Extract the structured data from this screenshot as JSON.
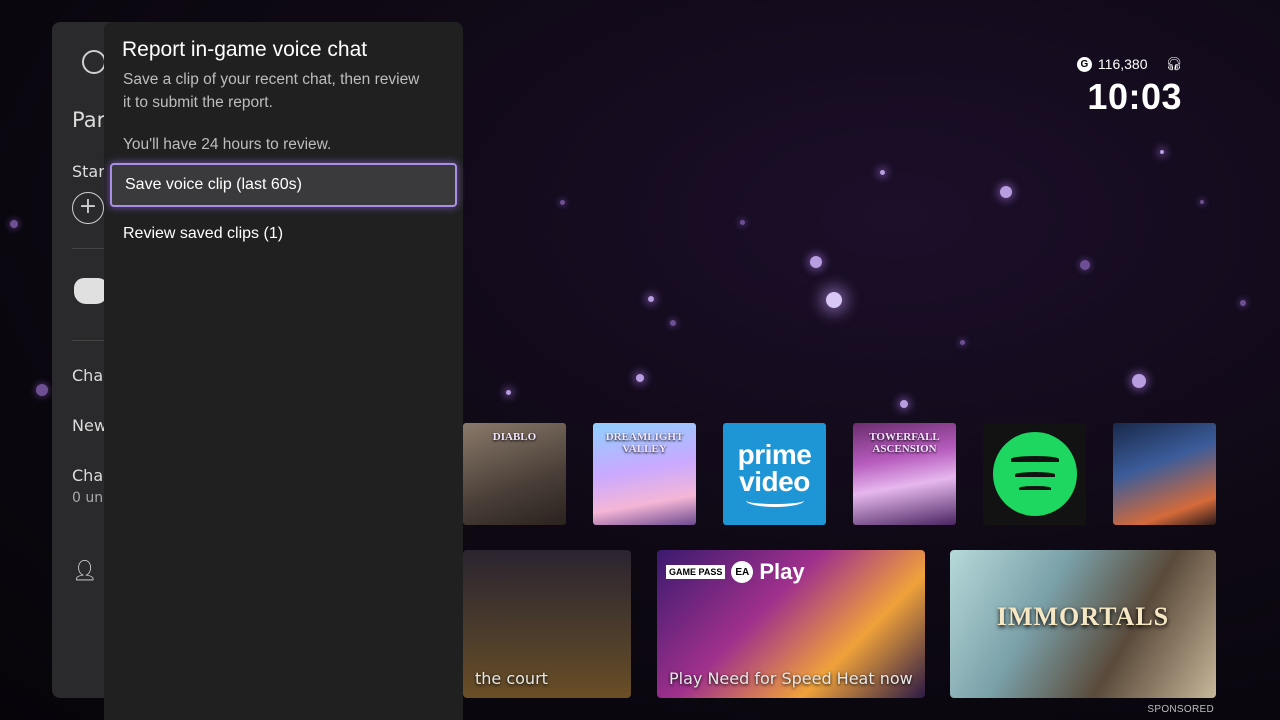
{
  "status_bar": {
    "gamerscore_icon": "G",
    "gamerscore": "116,380",
    "headset_icon": "headset-icon",
    "time": "10:03"
  },
  "tiles": [
    {
      "name": "diablo",
      "label": "DIABLO"
    },
    {
      "name": "dreamlight-valley",
      "label": "DREAMLIGHT VALLEY"
    },
    {
      "name": "prime-video",
      "label": "prime video"
    },
    {
      "name": "towerfall",
      "label": "TOWERFALL ASCENSION"
    },
    {
      "name": "spotify",
      "label": ""
    },
    {
      "name": "mass-effect",
      "label": ""
    }
  ],
  "cards": {
    "lakers_caption": "the court",
    "speed_badge_gp": "GAME PASS",
    "speed_badge_ea": "EA",
    "speed_badge_play": "Play",
    "speed_caption": "Play Need for Speed Heat now",
    "immortals_title": "IMMORTALS",
    "sponsored": "SPONSORED"
  },
  "party_panel": {
    "title": "Par",
    "start": "Star",
    "chat": "Cha",
    "news": "New",
    "chats": "Cha",
    "unread": "0 un"
  },
  "dialog": {
    "title": "Report in-game voice chat",
    "description": "Save a clip of your recent chat, then review it to submit the report.",
    "note": "You'll have 24 hours to review.",
    "options": [
      {
        "label": "Save voice clip (last 60s)",
        "selected": true
      },
      {
        "label": "Review saved clips (1)",
        "selected": false
      }
    ]
  },
  "colors": {
    "focus_outline": "#a98ee6",
    "dialog_bg": "#202020",
    "prime_blue": "#1e95d4",
    "spotify_green": "#1ed760"
  }
}
